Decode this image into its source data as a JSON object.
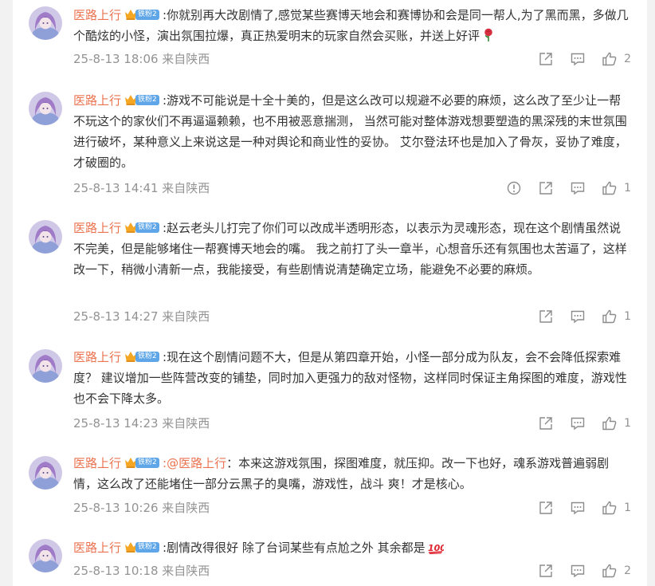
{
  "comments": [
    {
      "user": "医路上行",
      "fan_badge": "铁粉2",
      "mention": "",
      "text": ":你就别再大改剧情了,感觉某些赛博天地会和赛博协和会是同一帮人,为了黑而黑，多做几个酷炫的小怪，演出氛围拉爆，真正热爱明末的玩家自然会买账，并送上好评",
      "emoji": "rose",
      "time": "25-8-13 18:06 来自陕西",
      "likes": "2"
    },
    {
      "user": "医路上行",
      "fan_badge": "铁粉2",
      "mention": "",
      "text": ":游戏不可能说是十全十美的，但是这么改可以规避不必要的麻烦，这么改了至少让一帮不玩这个的家伙们不再逼逼赖赖，也不用被恶意揣测， 当然可能对整体游戏想要塑造的黑深残的末世氛围进行破坏，某种意义上来说这是一种对舆论和商业性的妥协。 艾尔登法环也是加入了骨灰，妥协了难度，才破圈的。",
      "emoji": "",
      "time": "25-8-13 14:41 来自陕西",
      "likes": "1"
    },
    {
      "user": "医路上行",
      "fan_badge": "铁粉2",
      "mention": "",
      "text": ":赵云老头儿打完了你们可以改成半透明形态，以表示为灵魂形态，现在这个剧情虽然说不完美，但是能够堵住一帮赛博天地会的嘴。 我之前打了头一章半，心想音乐还有氛围也太苦逼了，这样改一下，稍微小清新一点，我能接受，有些剧情说清楚确定立场，能避免不必要的麻烦。",
      "emoji": "",
      "time": "25-8-13 14:27 来自陕西",
      "likes": "1"
    },
    {
      "user": "医路上行",
      "fan_badge": "铁粉2",
      "mention": "",
      "text": ":现在这个剧情问题不大，但是从第四章开始，小怪一部分成为队友，会不会降低探索难度？ 建议增加一些阵营改变的铺垫，同时加入更强力的敌对怪物，这样同时保证主角探图的难度，游戏性也不会下降太多。",
      "emoji": "",
      "time": "25-8-13 14:23 来自陕西",
      "likes": "1"
    },
    {
      "user": "医路上行",
      "fan_badge": "铁粉2",
      "mention": ":@医路上行",
      "text": "：本来这游戏氛围，探图难度，就压抑。改一下也好，魂系游戏普遍弱剧情，这么改了还能堵住一部分云黑子的臭嘴，游戏性，战斗 爽！才是核心。",
      "emoji": "",
      "time": "25-8-13 10:26 来自陕西",
      "likes": "1"
    },
    {
      "user": "医路上行",
      "fan_badge": "铁粉2",
      "mention": "",
      "text": ":剧情改得很好 除了台词某些有点尬之外 其余都是",
      "emoji": "hundred",
      "time": "25-8-13 10:18 来自陕西",
      "likes": "2"
    }
  ]
}
